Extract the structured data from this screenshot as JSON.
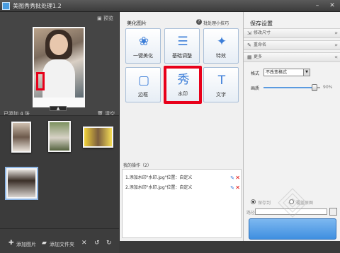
{
  "window": {
    "title": "美图秀秀批处理1.2"
  },
  "left_panel": {
    "preview_label": "预览",
    "handle_glyph": "▲",
    "added_label": "已添加 4 张",
    "clear_label": "清空",
    "toolbar": {
      "add_photo": "添加图片",
      "add_folder": "添加文件夹"
    }
  },
  "middle_panel": {
    "heading": "美化图片",
    "tips_link": "批处理小技巧",
    "tools": [
      {
        "label": "一键美化",
        "icon": "tulip-icon",
        "glyph": "❀"
      },
      {
        "label": "基础调整",
        "icon": "sliders-icon",
        "glyph": "☰"
      },
      {
        "label": "特效",
        "icon": "magic-wand-icon",
        "glyph": "✦"
      },
      {
        "label": "边框",
        "icon": "frame-icon",
        "glyph": "▢"
      },
      {
        "label": "水印",
        "icon": "watermark-icon",
        "glyph": "秀"
      },
      {
        "label": "文字",
        "icon": "text-icon",
        "glyph": "T"
      }
    ],
    "ops_heading": "我的操作（2）",
    "operations": [
      "1.添加水印\"水印.jpg\"位置：自定义",
      "2.添加水印\"水印.jpg\"位置：自定义"
    ]
  },
  "right_panel": {
    "heading": "保存设置",
    "sections": [
      {
        "label": "修改尺寸",
        "icon": "resize-icon",
        "glyph": "⇲",
        "arrow": "»"
      },
      {
        "label": "重命名",
        "icon": "rename-icon",
        "glyph": "✎",
        "arrow": "»"
      },
      {
        "label": "更多",
        "icon": "more-icon",
        "glyph": "▦",
        "arrow": "«"
      }
    ],
    "format_label": "格式",
    "format_value": "不改变格式",
    "quality_label": "画质",
    "quality_value": "90%",
    "quality_level": 0.9,
    "radio_labels": [
      "保存到",
      "覆盖原图"
    ],
    "path_label": "路径"
  },
  "colors": {
    "highlight_red": "#e8001a",
    "accent_blue": "#3b7dd8"
  }
}
